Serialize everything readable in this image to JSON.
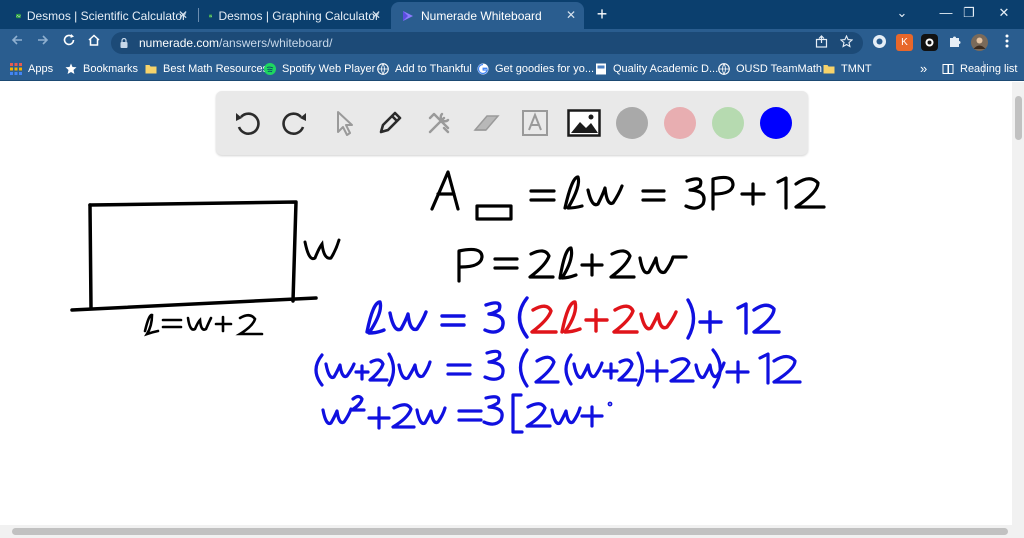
{
  "browser": {
    "tabs": [
      {
        "title": "Desmos | Scientific Calculator",
        "active": false
      },
      {
        "title": "Desmos | Graphing Calculator",
        "active": false
      },
      {
        "title": "Numerade Whiteboard",
        "active": true
      }
    ],
    "new_tab_symbol": "+",
    "window_controls": {
      "chevron": "⌄",
      "minimize": "—",
      "restore": "❐",
      "close": "✕"
    },
    "close_symbol": "✕",
    "url_host": "numerade.com",
    "url_path": "/answers/whiteboard/",
    "extension_k": "K",
    "bookmarks": [
      {
        "label": "Apps",
        "icon": "apps-grid-icon"
      },
      {
        "label": "Bookmarks",
        "icon": "star-icon"
      },
      {
        "label": "Best Math Resources",
        "icon": "folder-icon"
      },
      {
        "label": "Spotify Web Player",
        "icon": "spotify-icon"
      },
      {
        "label": "Add to Thankful",
        "icon": "globe-icon"
      },
      {
        "label": "Get goodies for yo...",
        "icon": "google-icon"
      },
      {
        "label": "Quality Academic D...",
        "icon": "doc-icon"
      },
      {
        "label": "OUSD TeamMath",
        "icon": "globe-icon"
      },
      {
        "label": "TMNT",
        "icon": "folder-icon"
      }
    ],
    "bookmarks_overflow": "»",
    "reading_list": "Reading list"
  },
  "whiteboard": {
    "tools": [
      "undo",
      "redo",
      "pointer",
      "pen",
      "tools",
      "eraser",
      "text",
      "image"
    ],
    "swatches": [
      {
        "name": "gray",
        "color": "#a9a9a9"
      },
      {
        "name": "pink",
        "color": "#e8aeb1"
      },
      {
        "name": "green",
        "color": "#b6dab0"
      },
      {
        "name": "blue",
        "color": "#0000ff",
        "selected": true
      }
    ],
    "handwriting": {
      "side_label": "w",
      "bottom_label": "l = w + 2",
      "eq1": "A□ = lw = 3P + 12",
      "eq2": "P = 2l + 2w",
      "eq3_a": "lw = 3(",
      "eq3_red": "2l + 2w",
      "eq3_b": ") + 12",
      "eq4": "(w+2)w = 3 (2(w+2) + 2w) + 12",
      "eq5": "w² + 2w = 3[2w + ·"
    }
  }
}
